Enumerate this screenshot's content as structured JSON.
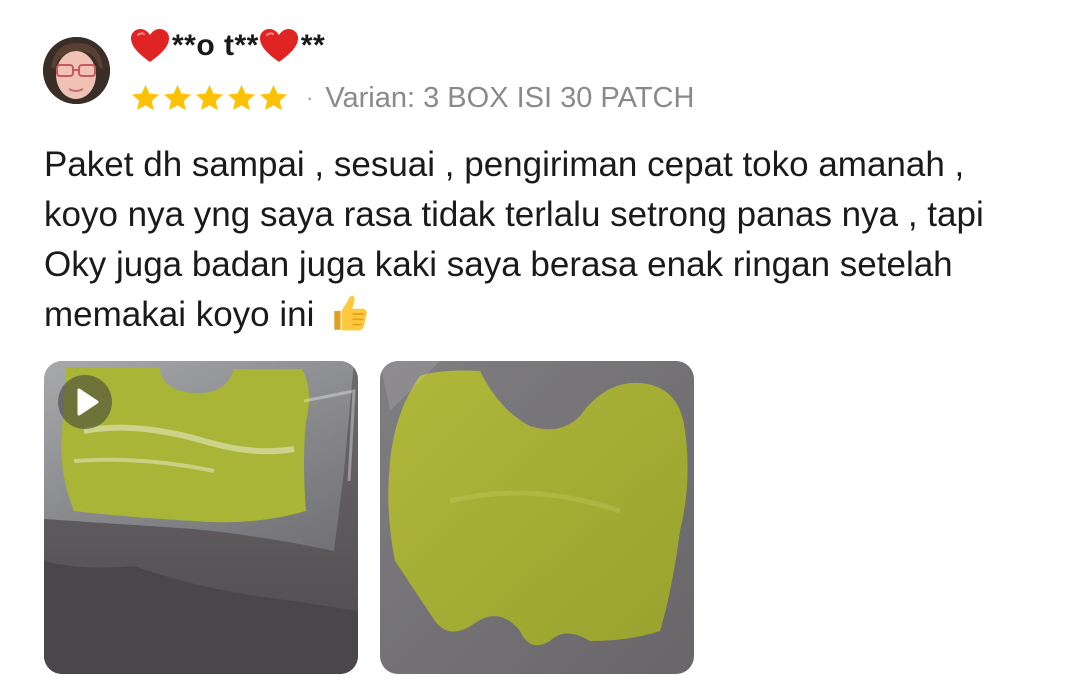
{
  "review": {
    "username": "**o t** ",
    "username_suffix": "**",
    "rating": 5,
    "rating_max": 5,
    "variant_separator": "·",
    "variant": "Varian: 3 BOX ISI 30 PATCH",
    "text": "Paket dh sampai , sesuai , pengiriman cepat toko amanah , koyo nya yng saya rasa tidak terlalu setrong panas nya , tapi Oky juga badan juga kaki saya berasa enak ringan setelah memakai koyo ini",
    "media": [
      {
        "type": "video"
      },
      {
        "type": "photo"
      }
    ]
  },
  "icons": {
    "avatar": "avatar-photo",
    "heart": "heart-icon",
    "star": "star-icon",
    "thumbs_up": "thumbs-up-emoji",
    "play": "play-icon"
  },
  "colors": {
    "star": "#FFC107",
    "heart": "#E02424",
    "variant_text": "#8A8A8A",
    "body_text": "#1A1A1A"
  }
}
